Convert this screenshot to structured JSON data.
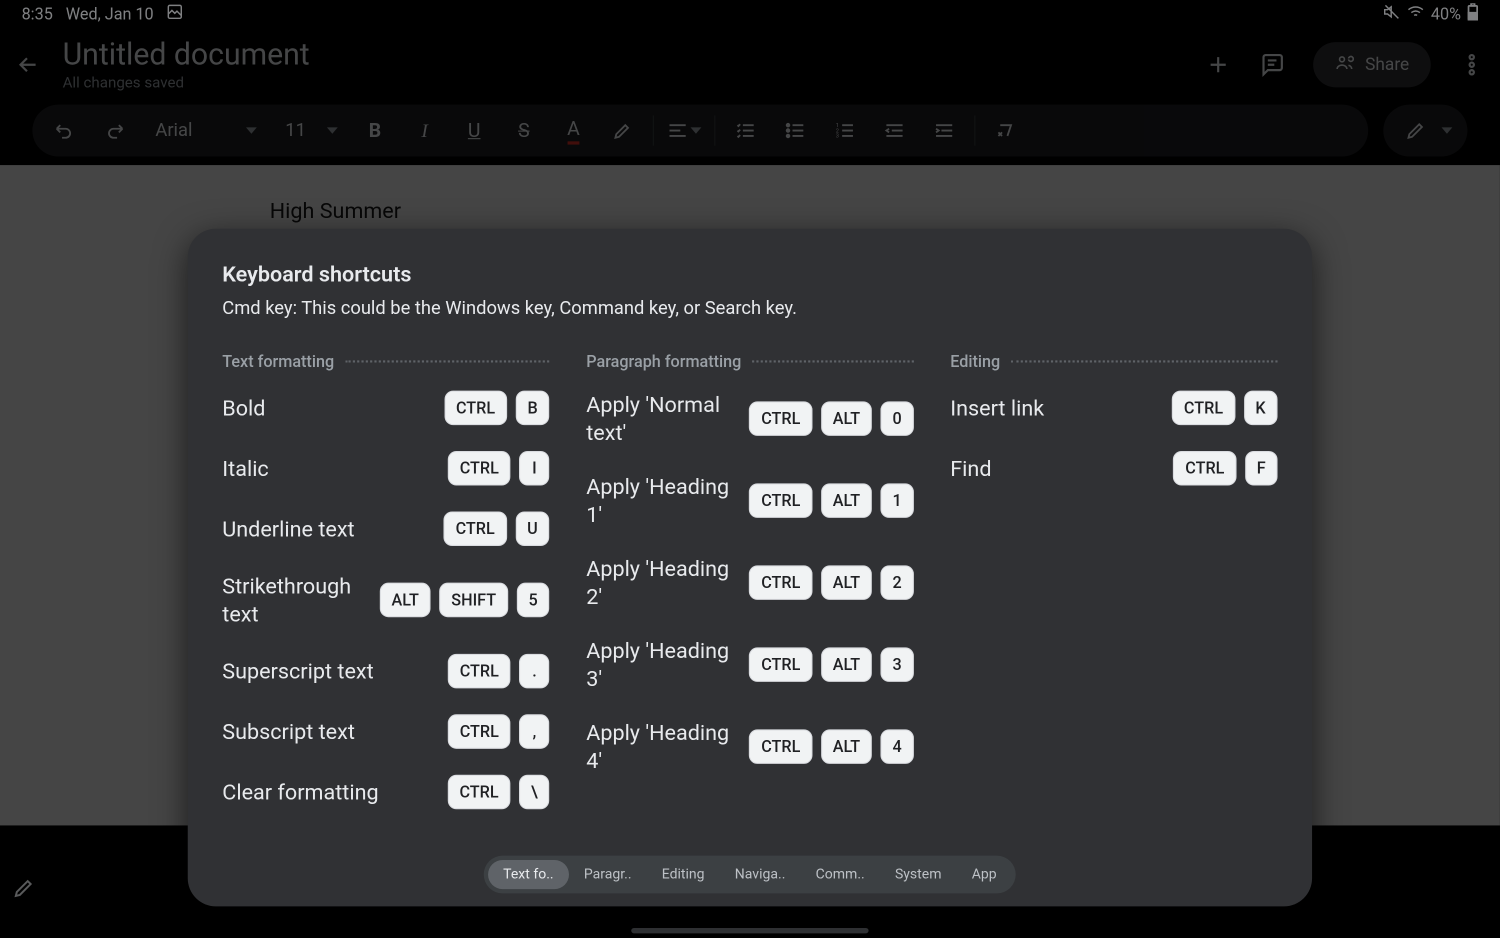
{
  "status": {
    "time": "8:35",
    "date": "Wed, Jan 10",
    "battery": "40%"
  },
  "header": {
    "title": "Untitled document",
    "subtitle": "All changes saved",
    "share": "Share"
  },
  "toolbar": {
    "font": "Arial",
    "size": "11"
  },
  "document": {
    "visible_text": "High Summer"
  },
  "modal": {
    "title": "Keyboard shortcuts",
    "subtitle": "Cmd key: This could be the Windows key, Command key, or Search key.",
    "columns": [
      {
        "title": "Text formatting",
        "rows": [
          {
            "label": "Bold",
            "keys": [
              "CTRL",
              "B"
            ]
          },
          {
            "label": "Italic",
            "keys": [
              "CTRL",
              "I"
            ]
          },
          {
            "label": "Underline text",
            "keys": [
              "CTRL",
              "U"
            ]
          },
          {
            "label": "Strikethrough text",
            "keys": [
              "ALT",
              "SHIFT",
              "5"
            ]
          },
          {
            "label": "Superscript text",
            "keys": [
              "CTRL",
              "."
            ]
          },
          {
            "label": "Subscript text",
            "keys": [
              "CTRL",
              ","
            ]
          },
          {
            "label": "Clear formatting",
            "keys": [
              "CTRL",
              "\\"
            ]
          }
        ]
      },
      {
        "title": "Paragraph formatting",
        "rows": [
          {
            "label": "Apply 'Normal text'",
            "keys": [
              "CTRL",
              "ALT",
              "0"
            ]
          },
          {
            "label": "Apply 'Heading 1'",
            "keys": [
              "CTRL",
              "ALT",
              "1"
            ]
          },
          {
            "label": "Apply 'Heading 2'",
            "keys": [
              "CTRL",
              "ALT",
              "2"
            ]
          },
          {
            "label": "Apply 'Heading 3'",
            "keys": [
              "CTRL",
              "ALT",
              "3"
            ]
          },
          {
            "label": "Apply 'Heading 4'",
            "keys": [
              "CTRL",
              "ALT",
              "4"
            ]
          }
        ]
      },
      {
        "title": "Editing",
        "rows": [
          {
            "label": "Insert link",
            "keys": [
              "CTRL",
              "K"
            ]
          },
          {
            "label": "Find",
            "keys": [
              "CTRL",
              "F"
            ]
          }
        ]
      }
    ],
    "tabs": [
      "Text fo..",
      "Paragr..",
      "Editing",
      "Naviga..",
      "Comm..",
      "System",
      "App"
    ],
    "active_tab": 0
  }
}
